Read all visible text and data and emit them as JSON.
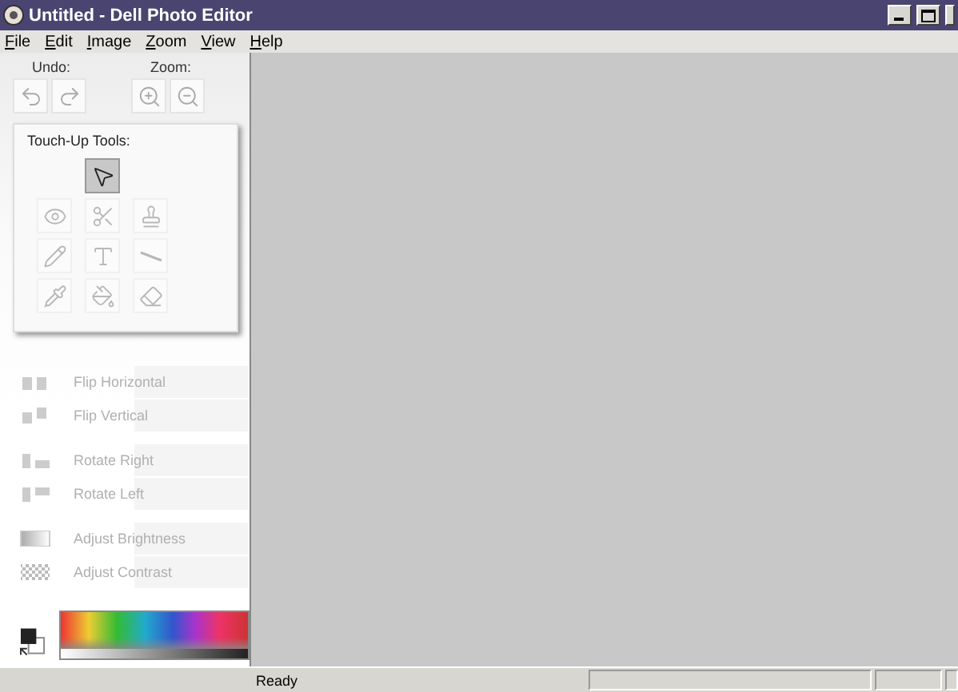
{
  "window": {
    "title": "Untitled - Dell Photo Editor"
  },
  "menu": [
    {
      "label": "File"
    },
    {
      "label": "Edit"
    },
    {
      "label": "Image"
    },
    {
      "label": "Zoom"
    },
    {
      "label": "View"
    },
    {
      "label": "Help"
    }
  ],
  "undo": {
    "label": "Undo:",
    "buttons": [
      {
        "kind": "undo",
        "disabled": true
      },
      {
        "kind": "redo",
        "disabled": true
      }
    ]
  },
  "zoom": {
    "label": "Zoom:",
    "buttons": [
      {
        "kind": "zoom-in",
        "disabled": true
      },
      {
        "kind": "zoom-out",
        "disabled": true
      }
    ]
  },
  "touch_up": {
    "title": "Touch-Up Tools:",
    "tools": [
      {
        "kind": "pointer",
        "selected": true,
        "disabled": false
      },
      {
        "kind": "eye",
        "selected": false,
        "disabled": true
      },
      {
        "kind": "scissors",
        "selected": false,
        "disabled": true
      },
      {
        "kind": "stamp",
        "selected": false,
        "disabled": true
      },
      {
        "kind": "pencil",
        "selected": false,
        "disabled": true
      },
      {
        "kind": "text",
        "selected": false,
        "disabled": true
      },
      {
        "kind": "line",
        "selected": false,
        "disabled": true
      },
      {
        "kind": "dropper",
        "selected": false,
        "disabled": true
      },
      {
        "kind": "fill",
        "selected": false,
        "disabled": true
      },
      {
        "kind": "eraser",
        "selected": false,
        "disabled": true
      }
    ]
  },
  "actions": [
    {
      "kind": "flip-h",
      "label": "Flip Horizontal",
      "disabled": true
    },
    {
      "kind": "flip-v",
      "label": "Flip Vertical",
      "disabled": true
    },
    {
      "kind": "rotate-r",
      "label": "Rotate Right",
      "disabled": true
    },
    {
      "kind": "rotate-l",
      "label": "Rotate Left",
      "disabled": true
    },
    {
      "kind": "brightness",
      "label": "Adjust Brightness",
      "disabled": true
    },
    {
      "kind": "contrast",
      "label": "Adjust Contrast",
      "disabled": true
    }
  ],
  "status_bar": {
    "text": "Ready"
  }
}
